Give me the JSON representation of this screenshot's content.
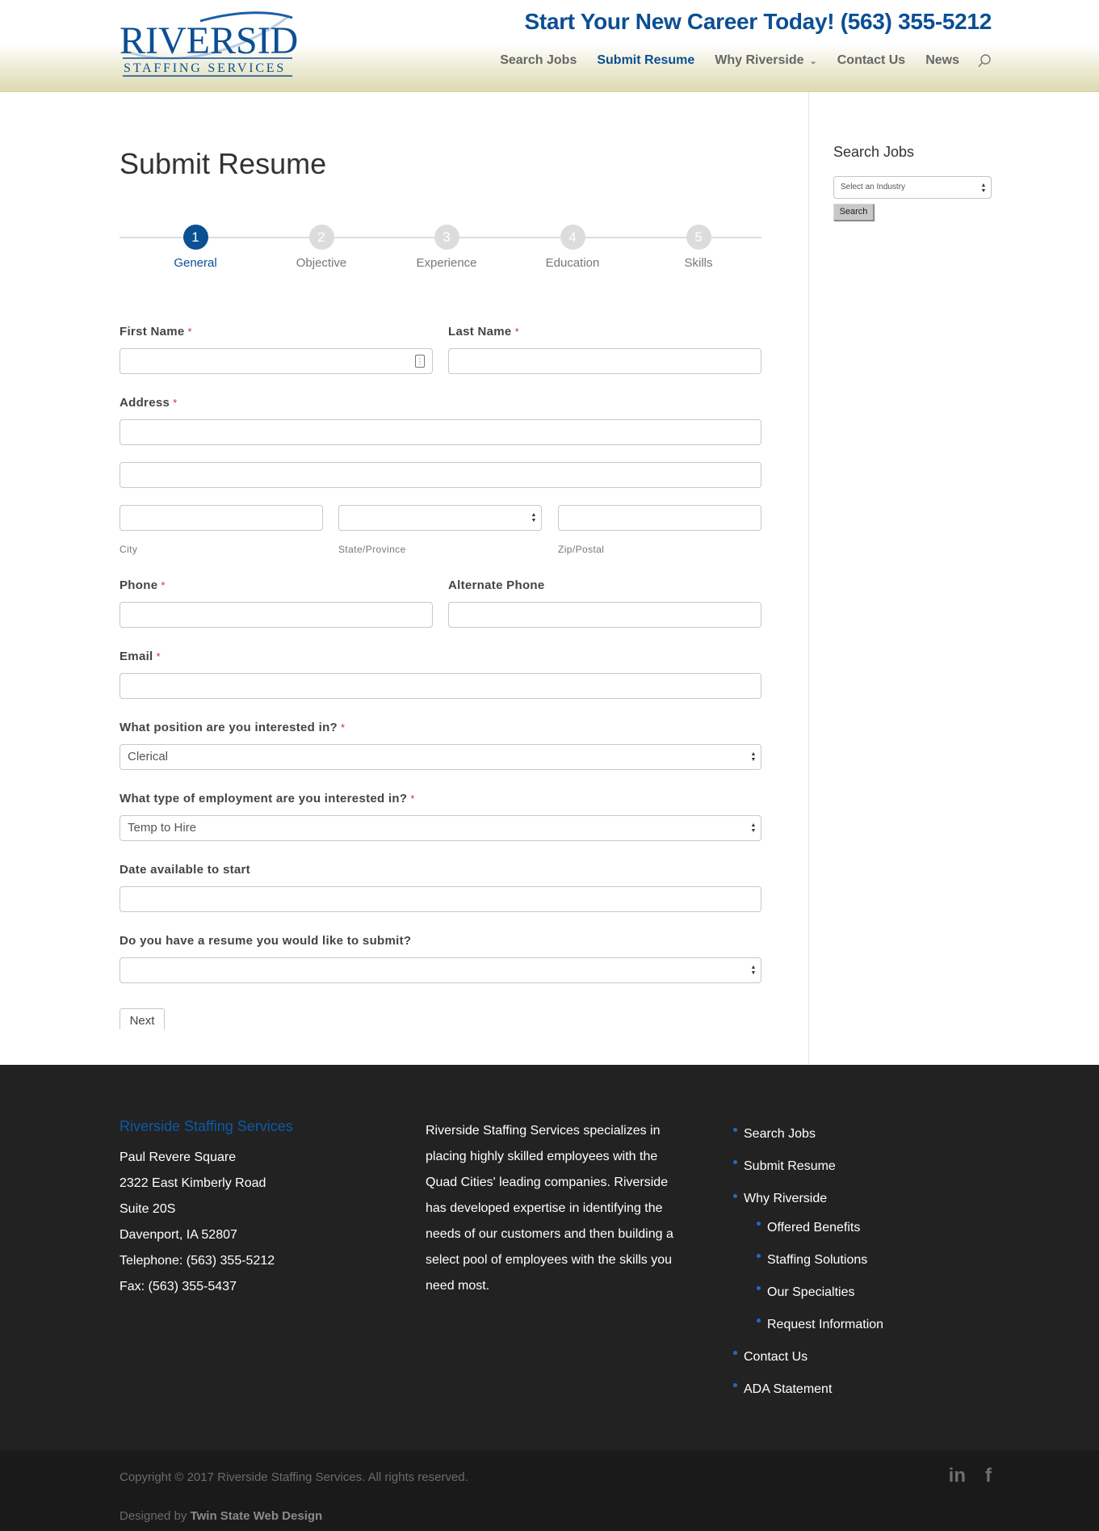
{
  "header": {
    "logo_main": "RIVERSIDE",
    "logo_sub": "STAFFING SERVICES",
    "tagline": "Start Your New Career Today! (563) 355-5212",
    "nav": [
      {
        "label": "Search Jobs",
        "active": false
      },
      {
        "label": "Submit Resume",
        "active": true
      },
      {
        "label": "Why Riverside",
        "active": false,
        "has_dropdown": true
      },
      {
        "label": "Contact Us",
        "active": false
      },
      {
        "label": "News",
        "active": false
      }
    ],
    "search_icon": "search-icon"
  },
  "main": {
    "title": "Submit Resume",
    "steps": [
      {
        "num": "1",
        "label": "General",
        "active": true
      },
      {
        "num": "2",
        "label": "Objective",
        "active": false
      },
      {
        "num": "3",
        "label": "Experience",
        "active": false
      },
      {
        "num": "4",
        "label": "Education",
        "active": false
      },
      {
        "num": "5",
        "label": "Skills",
        "active": false
      }
    ],
    "form": {
      "required_mark": "*",
      "first_name_label": "First Name",
      "first_name_value": "",
      "last_name_label": "Last Name",
      "last_name_value": "",
      "address_label": "Address",
      "address_line1_value": "",
      "address_line2_value": "",
      "city_label": "City",
      "city_value": "",
      "state_label": "State/Province",
      "state_value": "",
      "zip_label": "Zip/Postal",
      "zip_value": "",
      "phone_label": "Phone",
      "phone_value": "",
      "alt_phone_label": "Alternate Phone",
      "alt_phone_value": "",
      "email_label": "Email",
      "email_value": "",
      "position_label": "What position are you interested in?",
      "position_value": "Clerical",
      "employment_label": "What type of employment are you interested in?",
      "employment_value": "Temp to Hire",
      "date_label": "Date available to start",
      "date_value": "",
      "resume_label": "Do you have a resume you would like to submit?",
      "resume_value": "",
      "next_label": "Next"
    }
  },
  "sidebar": {
    "title": "Search Jobs",
    "select_value": "Select an Industry",
    "button_label": "Search"
  },
  "footer": {
    "company": "Riverside Staffing Services",
    "address_lines": [
      "Paul Revere Square",
      "2322 East Kimberly Road",
      "Suite 20S",
      "Davenport, IA 52807",
      "Telephone: (563) 355-5212",
      "Fax: (563) 355-5437"
    ],
    "about": "Riverside Staffing Services specializes in placing highly skilled employees with the Quad Cities' leading companies. Riverside has developed expertise in identifying the needs of our customers and then building a select pool of employees with the skills you need most.",
    "links": [
      {
        "label": "Search Jobs"
      },
      {
        "label": "Submit Resume"
      },
      {
        "label": "Why Riverside"
      },
      {
        "label": "Offered Benefits",
        "sub": true
      },
      {
        "label": "Staffing Solutions",
        "sub": true
      },
      {
        "label": "Our Specialties",
        "sub": true
      },
      {
        "label": "Request Information",
        "sub": true
      },
      {
        "label": "Contact Us"
      },
      {
        "label": "ADA Statement"
      }
    ],
    "copyright": "Copyright © 2017 Riverside Staffing Services. All rights reserved.",
    "designed_prefix": "Designed by",
    "designer": "Twin State Web Design",
    "social": [
      {
        "icon": "linkedin-icon",
        "glyph": "in"
      },
      {
        "icon": "facebook-icon",
        "glyph": "f"
      }
    ]
  },
  "colors": {
    "brand_blue": "#0b4f94",
    "footer_bg": "#222222",
    "bottom_bar_bg": "#1a1a1a",
    "required_red": "#c0392b"
  }
}
